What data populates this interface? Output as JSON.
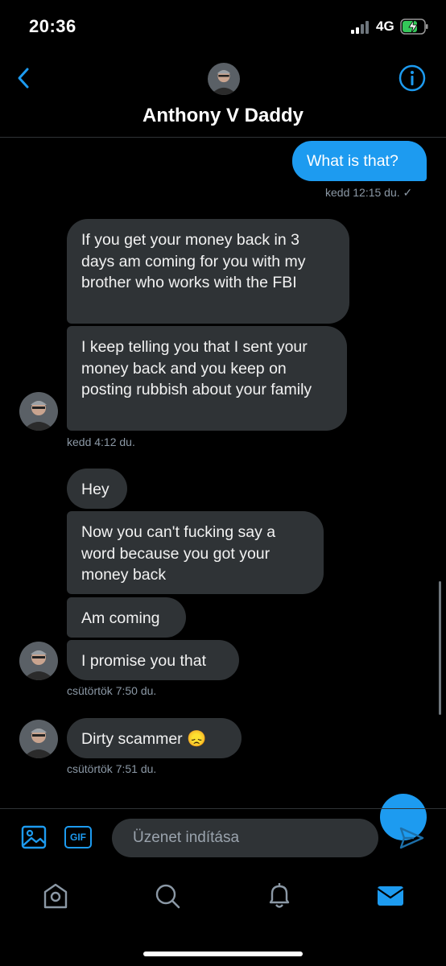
{
  "status_bar": {
    "time": "20:36",
    "network": "4G",
    "battery": "charging"
  },
  "header": {
    "contact_name": "Anthony V Daddy"
  },
  "messages": {
    "m0": {
      "text": "What is that?",
      "meta": "kedd 12:15 du. ✓"
    },
    "m1": {
      "text": "If you get your money back in 3 days am coming for you with my brother who works with the FBI"
    },
    "m2": {
      "text": "I keep telling you that I sent your money back and you keep on posting rubbish about your family",
      "meta": "kedd 4:12 du."
    },
    "m3": {
      "text": "Hey"
    },
    "m4": {
      "text": "Now you can't fucking say a word because you got your money back"
    },
    "m5": {
      "text": "Am coming"
    },
    "m6": {
      "text": "I promise you that",
      "meta": "csütörtök 7:50 du."
    },
    "m7": {
      "text": "Dirty scammer 😞",
      "meta": "csütörtök 7:51 du."
    }
  },
  "composer": {
    "placeholder": "Üzenet indítása",
    "gif_label": "GIF"
  },
  "tabs": [
    "home-icon",
    "search-icon",
    "notifications-icon",
    "messages-icon"
  ],
  "colors": {
    "accent": "#1d9bf0",
    "bubble_in": "#2f3336",
    "background": "#000000",
    "meta": "#8b98a5"
  }
}
